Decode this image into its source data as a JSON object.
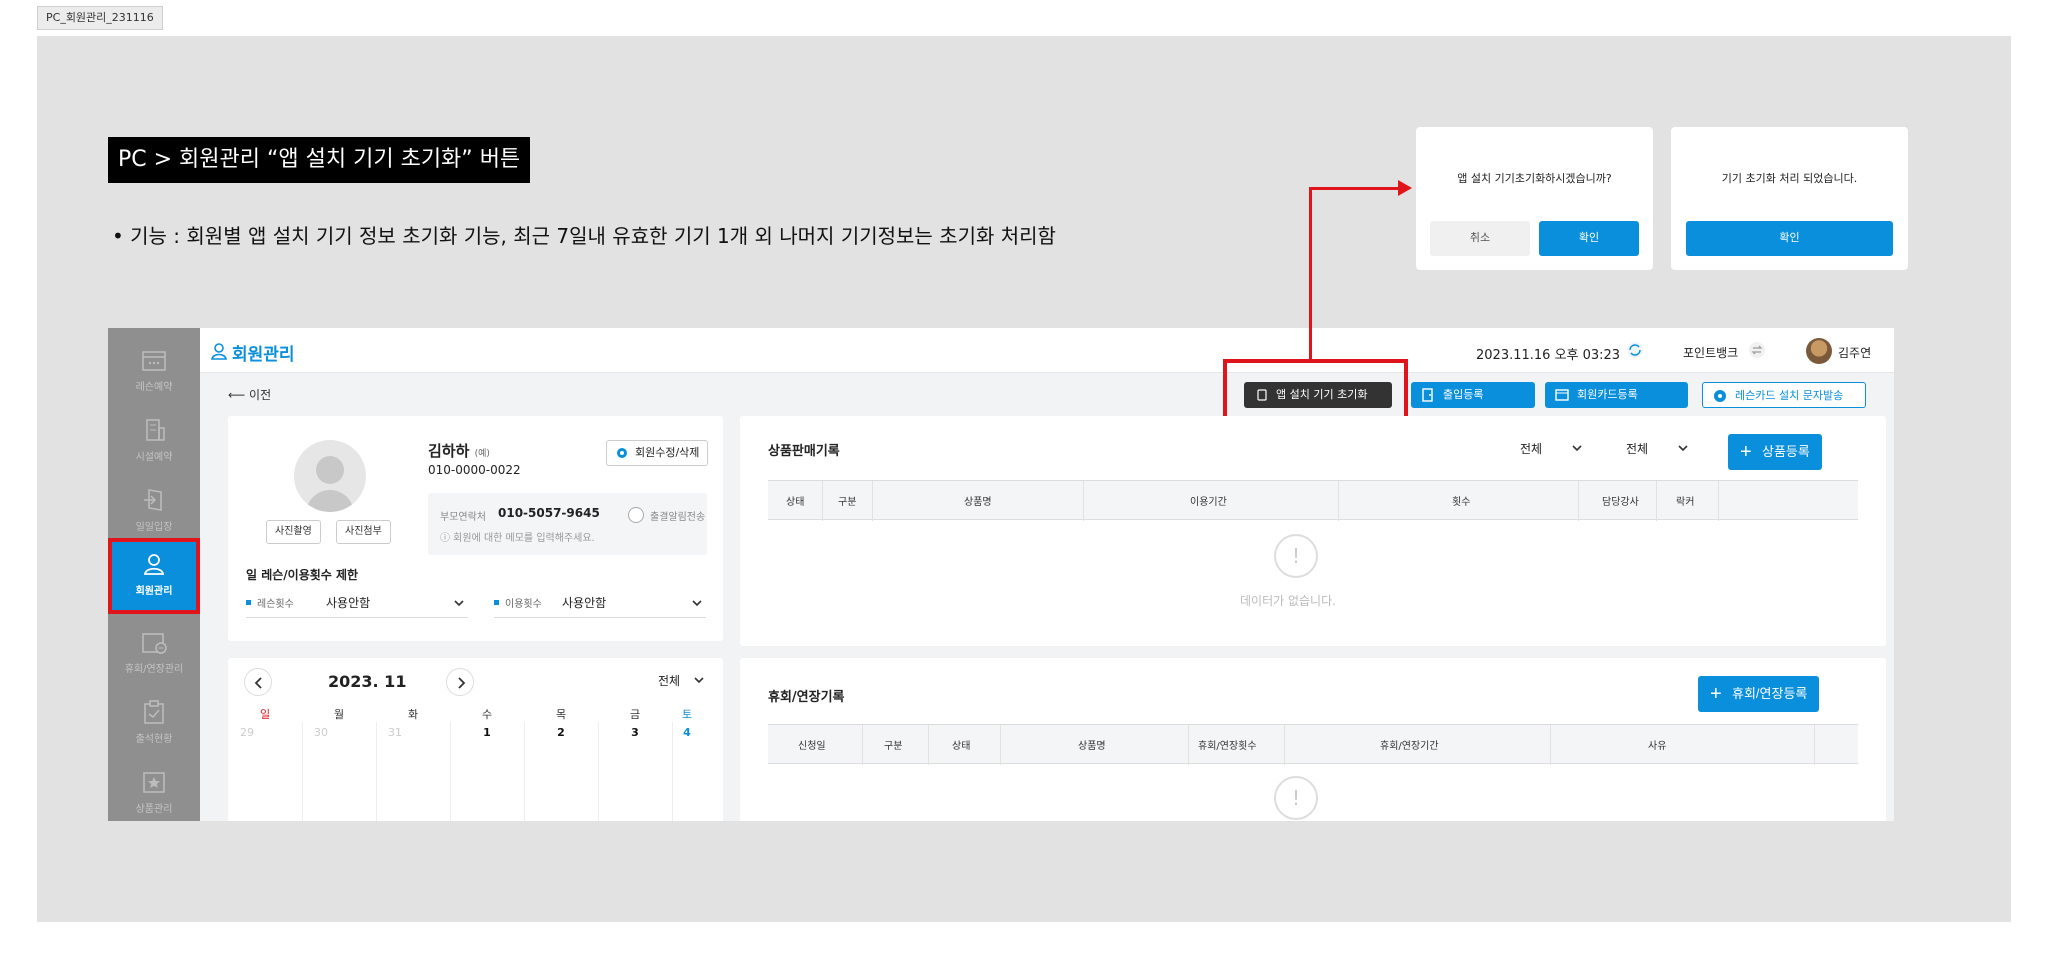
{
  "frame_label": "PC_회원관리_231116",
  "spec": {
    "title": "PC > 회원관리  “앱 설치 기기 초기화” 버튼",
    "description": "•  기능 : 회원별 앱 설치 기기 정보 초기화 기능, 최근 7일내 유효한 기기 1개 외 나머지 기기정보는 초기화 처리함"
  },
  "dialog_confirm": {
    "message": "앱 설치 기기초기화하시겠습니까?",
    "cancel": "취소",
    "ok": "확인"
  },
  "dialog_done": {
    "message": "기기 초기화 처리 되었습니다.",
    "ok": "확인"
  },
  "sidebar": {
    "items": [
      {
        "label": "레슨예약",
        "icon": "calendar-icon"
      },
      {
        "label": "시설예약",
        "icon": "building-icon"
      },
      {
        "label": "일일입장",
        "icon": "entry-icon"
      },
      {
        "label": "회원관리",
        "icon": "person-icon",
        "active": true
      },
      {
        "label": "휴회/연장관리",
        "icon": "calendar-pause-icon"
      },
      {
        "label": "출석현황",
        "icon": "clipboard-check-icon"
      },
      {
        "label": "상품관리",
        "icon": "star-box-icon"
      }
    ]
  },
  "header": {
    "title": "회원관리",
    "datetime": "2023.11.16 오후 03:23",
    "pointbank": "포인트뱅크",
    "username": "김주연"
  },
  "toolbar": {
    "back": "이전",
    "reset_device": "앱 설치 기기 초기화",
    "entry_register": "출입등록",
    "card_register": "회원카드등록",
    "lesson_card_sms": "레슨카드 설치 문자발송"
  },
  "member": {
    "name": "김하하",
    "name_suffix": "(예)",
    "phone": "010-0000-0022",
    "edit_button": "회원수정/삭제",
    "photo_take": "사진촬영",
    "photo_attach": "사진첨부",
    "parent_label": "부모연락처",
    "parent_phone": "010-5057-9645",
    "attendance_alarm": "출결알림전송",
    "memo_placeholder": "ⓘ 회원에 대한 메모를 입력해주세요.",
    "limit_title": "일 레슨/이용횟수 제한",
    "lesson_count_label": "레슨횟수",
    "lesson_count_value": "사용안함",
    "use_count_label": "이용횟수",
    "use_count_value": "사용안함"
  },
  "calendar": {
    "month": "2023. 11",
    "filter": "전체",
    "weekdays": [
      "일",
      "월",
      "화",
      "수",
      "목",
      "금",
      "토"
    ],
    "days": [
      "29",
      "30",
      "31",
      "1",
      "2",
      "3",
      "4"
    ]
  },
  "sales": {
    "title": "상품판매기록",
    "filter1": "전체",
    "filter2": "전체",
    "add_button": "상품등록",
    "columns": [
      "상태",
      "구분",
      "상품명",
      "이용기간",
      "횟수",
      "담당강사",
      "락커"
    ],
    "empty_text": "데이터가 없습니다."
  },
  "leave": {
    "title": "휴회/연장기록",
    "add_button": "휴회/연장등록",
    "columns": [
      "신청일",
      "구분",
      "상태",
      "상품명",
      "휴회/연장횟수",
      "휴회/연장기간",
      "사유"
    ]
  },
  "colors": {
    "accent": "#0a8fdc",
    "highlight": "#e0141b",
    "sidebar": "#8f8f8f",
    "board": "#e2e2e2"
  }
}
